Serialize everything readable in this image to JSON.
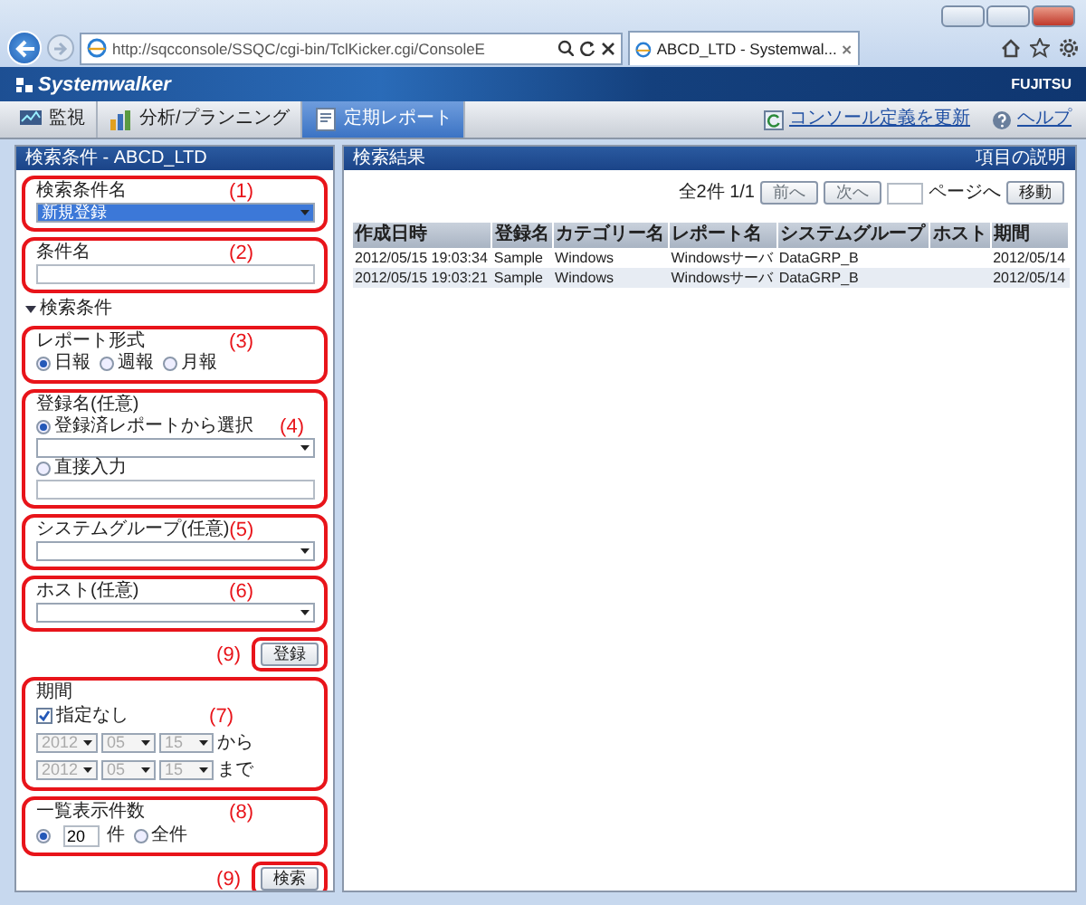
{
  "browser": {
    "url": "http://sqcconsole/SSQC/cgi-bin/TclKicker.cgi/ConsoleE",
    "tab_title": "ABCD_LTD - Systemwal..."
  },
  "app": {
    "logo": "Systemwalker",
    "brand": "FUJITSU"
  },
  "nav_tabs": [
    {
      "label": "監視",
      "selected": false
    },
    {
      "label": "分析/プランニング",
      "selected": false
    },
    {
      "label": "定期レポート",
      "selected": true
    }
  ],
  "nav_links": [
    "コンソール定義を更新",
    "ヘルプ"
  ],
  "left_panel": {
    "title": "検索条件 - ABCD_LTD",
    "sections": [
      {
        "kind": "select",
        "callout": "(1)",
        "label": "検索条件名",
        "value": "新規登録",
        "focused": true
      },
      {
        "kind": "text",
        "callout": "(2)",
        "label": "条件名"
      },
      {
        "kind": "toggle",
        "label": "検索条件",
        "expanded": true
      },
      {
        "kind": "radios",
        "callout": "(3)",
        "label": "レポート形式",
        "options": [
          {
            "label": "日報",
            "selected": true
          },
          {
            "label": "週報",
            "selected": false
          },
          {
            "label": "月報",
            "selected": false
          }
        ]
      },
      {
        "kind": "register",
        "callout": "(4)",
        "label": "登録名(任意)",
        "options": [
          {
            "label": "登録済レポートから選択",
            "selected": true
          },
          {
            "label": "直接入力",
            "selected": false
          }
        ]
      },
      {
        "kind": "select",
        "callout": "(5)",
        "label": "システムグループ(任意)",
        "focused": false
      },
      {
        "kind": "select",
        "callout": "(6)",
        "label": "ホスト(任意)",
        "focused": false
      },
      {
        "kind": "button",
        "callout": "(9)",
        "label": "登録"
      },
      {
        "kind": "period",
        "callout": "(7)",
        "label": "期間",
        "checkbox": {
          "label": "指定なし",
          "checked": true
        },
        "rows": [
          {
            "year": "2012",
            "month": "05",
            "day": "15",
            "suffix": "から"
          },
          {
            "year": "2012",
            "month": "05",
            "day": "15",
            "suffix": "まで"
          }
        ]
      },
      {
        "kind": "count",
        "callout": "(8)",
        "label": "一覧表示件数",
        "options": [
          {
            "value": "20",
            "unit": "件",
            "selected": true
          },
          {
            "label": "全件",
            "selected": false
          }
        ]
      },
      {
        "kind": "button",
        "callout": "(9)",
        "label": "検索"
      }
    ]
  },
  "right_panel": {
    "title": "検索結果",
    "link": "項目の説明",
    "pager": {
      "summary": "全2件 1/1",
      "prev": "前へ",
      "next": "次へ",
      "page_suffix": "ページへ",
      "go": "移動"
    },
    "table": {
      "columns": [
        "作成日時",
        "登録名",
        "カテゴリー名",
        "レポート名",
        "システムグループ",
        "ホスト",
        "期間"
      ],
      "rows": [
        [
          "2012/05/15 19:03:34",
          "Sample",
          "Windows",
          "Windowsサーバ",
          "DataGRP_B",
          "",
          "2012/05/14"
        ],
        [
          "2012/05/15 19:03:21",
          "Sample",
          "Windows",
          "Windowsサーバ",
          "DataGRP_B",
          "",
          "2012/05/14"
        ]
      ]
    }
  }
}
